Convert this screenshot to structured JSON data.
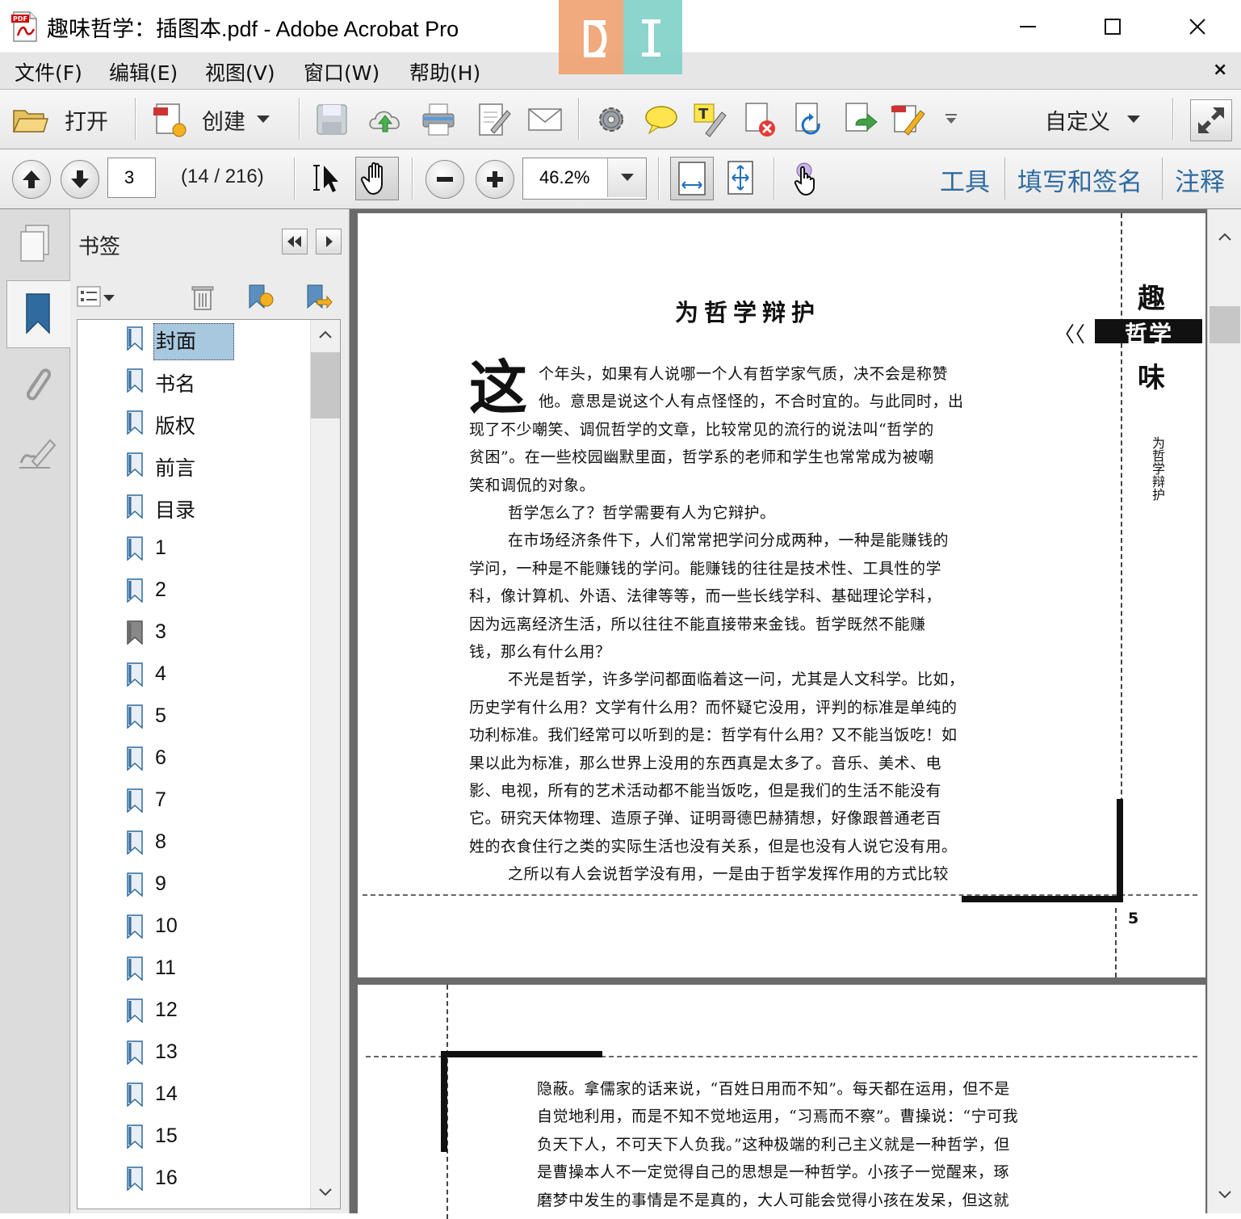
{
  "window": {
    "title": "趣味哲学：插图本.pdf - Adobe Acrobat Pro",
    "minimize_label": "—",
    "maximize_label": "☐",
    "close_label": "✕"
  },
  "menu": {
    "items": [
      "文件(F)",
      "编辑(E)",
      "视图(V)",
      "窗口(W)",
      "帮助(H)"
    ],
    "close_label": "×"
  },
  "toolbar": {
    "open_label": "打开",
    "create_label": "创建",
    "customize_label": "自定义"
  },
  "nav": {
    "current_page": "3",
    "page_count": "(14 / 216)",
    "zoom": "46.2%"
  },
  "panes": {
    "tools": "工具",
    "fill_sign": "填写和签名",
    "comment": "注释"
  },
  "bookmarks": {
    "title": "书签",
    "items": [
      {
        "label": "封面"
      },
      {
        "label": "书名"
      },
      {
        "label": "版权"
      },
      {
        "label": "前言"
      },
      {
        "label": "目录"
      },
      {
        "label": "1"
      },
      {
        "label": "2"
      },
      {
        "label": "3"
      },
      {
        "label": "4"
      },
      {
        "label": "5"
      },
      {
        "label": "6"
      },
      {
        "label": "7"
      },
      {
        "label": "8"
      },
      {
        "label": "9"
      },
      {
        "label": "10"
      },
      {
        "label": "11"
      },
      {
        "label": "12"
      },
      {
        "label": "13"
      },
      {
        "label": "14"
      },
      {
        "label": "15"
      },
      {
        "label": "16"
      }
    ]
  },
  "page1": {
    "chapter_title": "为哲学辩护",
    "drop_cap": "这",
    "lines": [
      "个年头，如果有人说哪一个人有哲学家气质，决不会是称赞",
      "他。意思是说这个人有点怪怪的，不合时宜的。与此同时，出",
      "现了不少嘲笑、调侃哲学的文章，比较常见的流行的说法叫“哲学的",
      "贫困”。在一些校园幽默里面，哲学系的老师和学生也常常成为被嘲",
      "笑和调侃的对象。",
      "哲学怎么了？哲学需要有人为它辩护。",
      "在市场经济条件下，人们常常把学问分成两种，一种是能赚钱的",
      "学问，一种是不能赚钱的学问。能赚钱的往往是技术性、工具性的学",
      "科，像计算机、外语、法律等等，而一些长线学科、基础理论学科，",
      "因为远离经济生活，所以往往不能直接带来金钱。哲学既然不能赚",
      "钱，那么有什么用？",
      "不光是哲学，许多学问都面临着这一问，尤其是人文科学。比如，",
      "历史学有什么用？文学有什么用？而怀疑它没用，评判的标准是单纯的",
      "功利标准。我们经常可以听到的是：哲学有什么用？又不能当饭吃！如",
      "果以此为标准，那么世界上没用的东西真是太多了。音乐、美术、电",
      "影、电视，所有的艺术活动都不能当饭吃，但是我们的生活不能没有",
      "它。研究天体物理、造原子弹、证明哥德巴赫猜想，好像跟普通老百",
      "姓的衣食住行之类的实际生活也没有关系，但是也没有人说它没有用。",
      "之所以有人会说哲学没有用，一是由于哲学发挥作用的方式比较"
    ],
    "side_title_1": "趣",
    "side_title_2": "哲学",
    "side_title_3": "味",
    "side_chevrons": "〈〈",
    "side_subtitle": "为哲学辩护",
    "page_number": "5"
  },
  "page2": {
    "lines": [
      "隐蔽。拿儒家的话来说，“百姓日用而不知”。每天都在运用，但不是",
      "自觉地利用，而是不知不觉地运用，“习焉而不察”。曹操说：“宁可我",
      "负天下人，不可天下人负我。”这种极端的利己主义就是一种哲学，但",
      "是曹操本人不一定觉得自己的思想是一种哲学。小孩子一觉醒来，琢",
      "磨梦中发生的事情是不是真的，大人可能会觉得小孩在发呆，但这就"
    ]
  }
}
